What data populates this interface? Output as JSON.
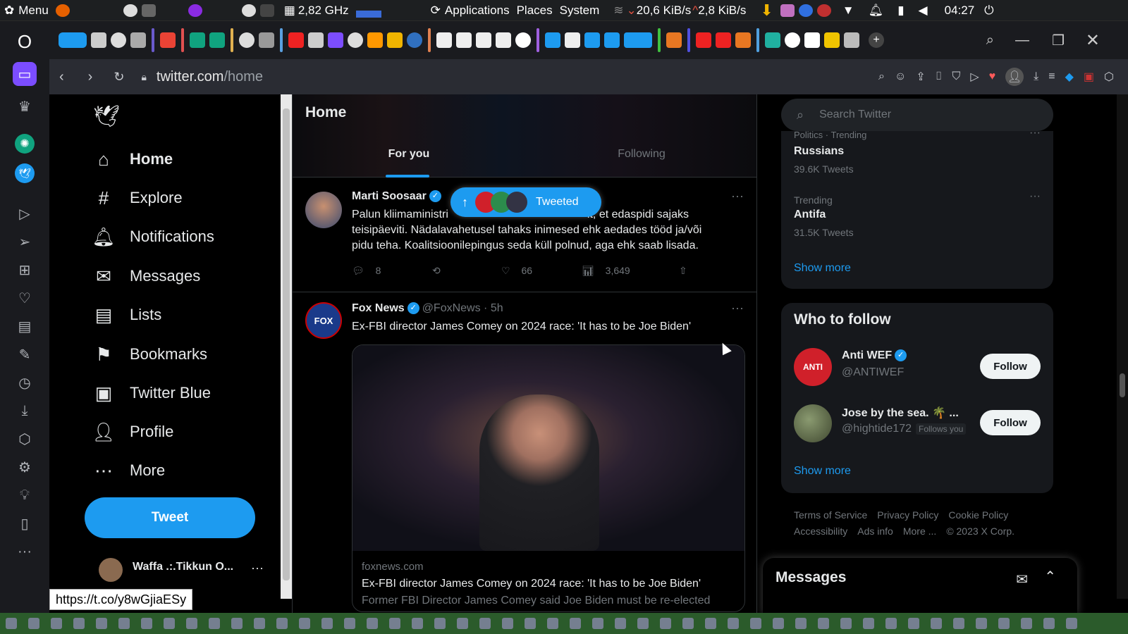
{
  "system": {
    "menu_label": "Menu",
    "cpu": "2,82 GHz",
    "applications": "Applications",
    "places": "Places",
    "system": "System",
    "net_down": "20,6 KiB/s",
    "net_up": "2,8 KiB/s",
    "clock": "04:27"
  },
  "browser": {
    "url_domain": "twitter.com",
    "url_path": "/home",
    "status_url": "https://t.co/y8wGjiaESy"
  },
  "nav": {
    "home": "Home",
    "explore": "Explore",
    "notifications": "Notifications",
    "messages": "Messages",
    "lists": "Lists",
    "bookmarks": "Bookmarks",
    "twitter_blue": "Twitter Blue",
    "profile": "Profile",
    "more": "More",
    "tweet_button": "Tweet",
    "account_name": "Waffa .:.Tikkun O...",
    "account_more": "···"
  },
  "timeline": {
    "title": "Home",
    "tab_for_you": "For you",
    "tab_following": "Following",
    "tweeted_pill": "Tweeted",
    "tweets": [
      {
        "name": "Marti Soosaar",
        "text": "Palun kliimaministri... it, et edaspidi sajaks teisipäeviti. Nädalavahetusel tahaks inimesed ehk aedades tööd ja/või pidu teha. Koalitsioonilepingus seda küll polnud, aga ehk saab lisada.",
        "text_l1a": "Palun kliimaministri",
        "text_l1b": "it, et edaspidi sajaks",
        "text_l2": "teisipäeviti. Nädalavahetusel tahaks inimesed ehk aedades tööd ja/või",
        "text_l3": "pidu teha. Koalitsioonilepingus seda küll polnud, aga ehk saab lisada.",
        "replies": "8",
        "likes": "66",
        "views": "3,649"
      },
      {
        "name": "Fox News",
        "handle": "@FoxNews · 5h",
        "text": "Ex-FBI director James Comey on 2024 race: 'It has to be Joe Biden'",
        "card_domain": "foxnews.com",
        "card_title": "Ex-FBI director James Comey on 2024 race: 'It has to be Joe Biden'",
        "card_desc": "Former FBI Director James Comey said Joe Biden must be re-elected"
      }
    ]
  },
  "right": {
    "search_placeholder": "Search Twitter",
    "trends": [
      {
        "context": "Politics · Trending",
        "name": "Russians",
        "count": "39.6K Tweets"
      },
      {
        "context": "Trending",
        "name": "Antifa",
        "count": "31.5K Tweets"
      }
    ],
    "show_more_trends": "Show more",
    "who_to_follow_title": "Who to follow",
    "suggestions": [
      {
        "name": "Anti WEF",
        "handle": "@ANTIWEF",
        "button": "Follow"
      },
      {
        "name": "Jose by the sea. 🌴 ...",
        "handle": "@hightide172",
        "badge": "Follows you",
        "button": "Follow"
      }
    ],
    "show_more_follow": "Show more",
    "footer": {
      "terms": "Terms of Service",
      "privacy": "Privacy Policy",
      "cookie": "Cookie Policy",
      "accessibility": "Accessibility",
      "ads": "Ads info",
      "more": "More ...",
      "copyright": "© 2023 X Corp."
    },
    "messages_drawer": "Messages"
  }
}
